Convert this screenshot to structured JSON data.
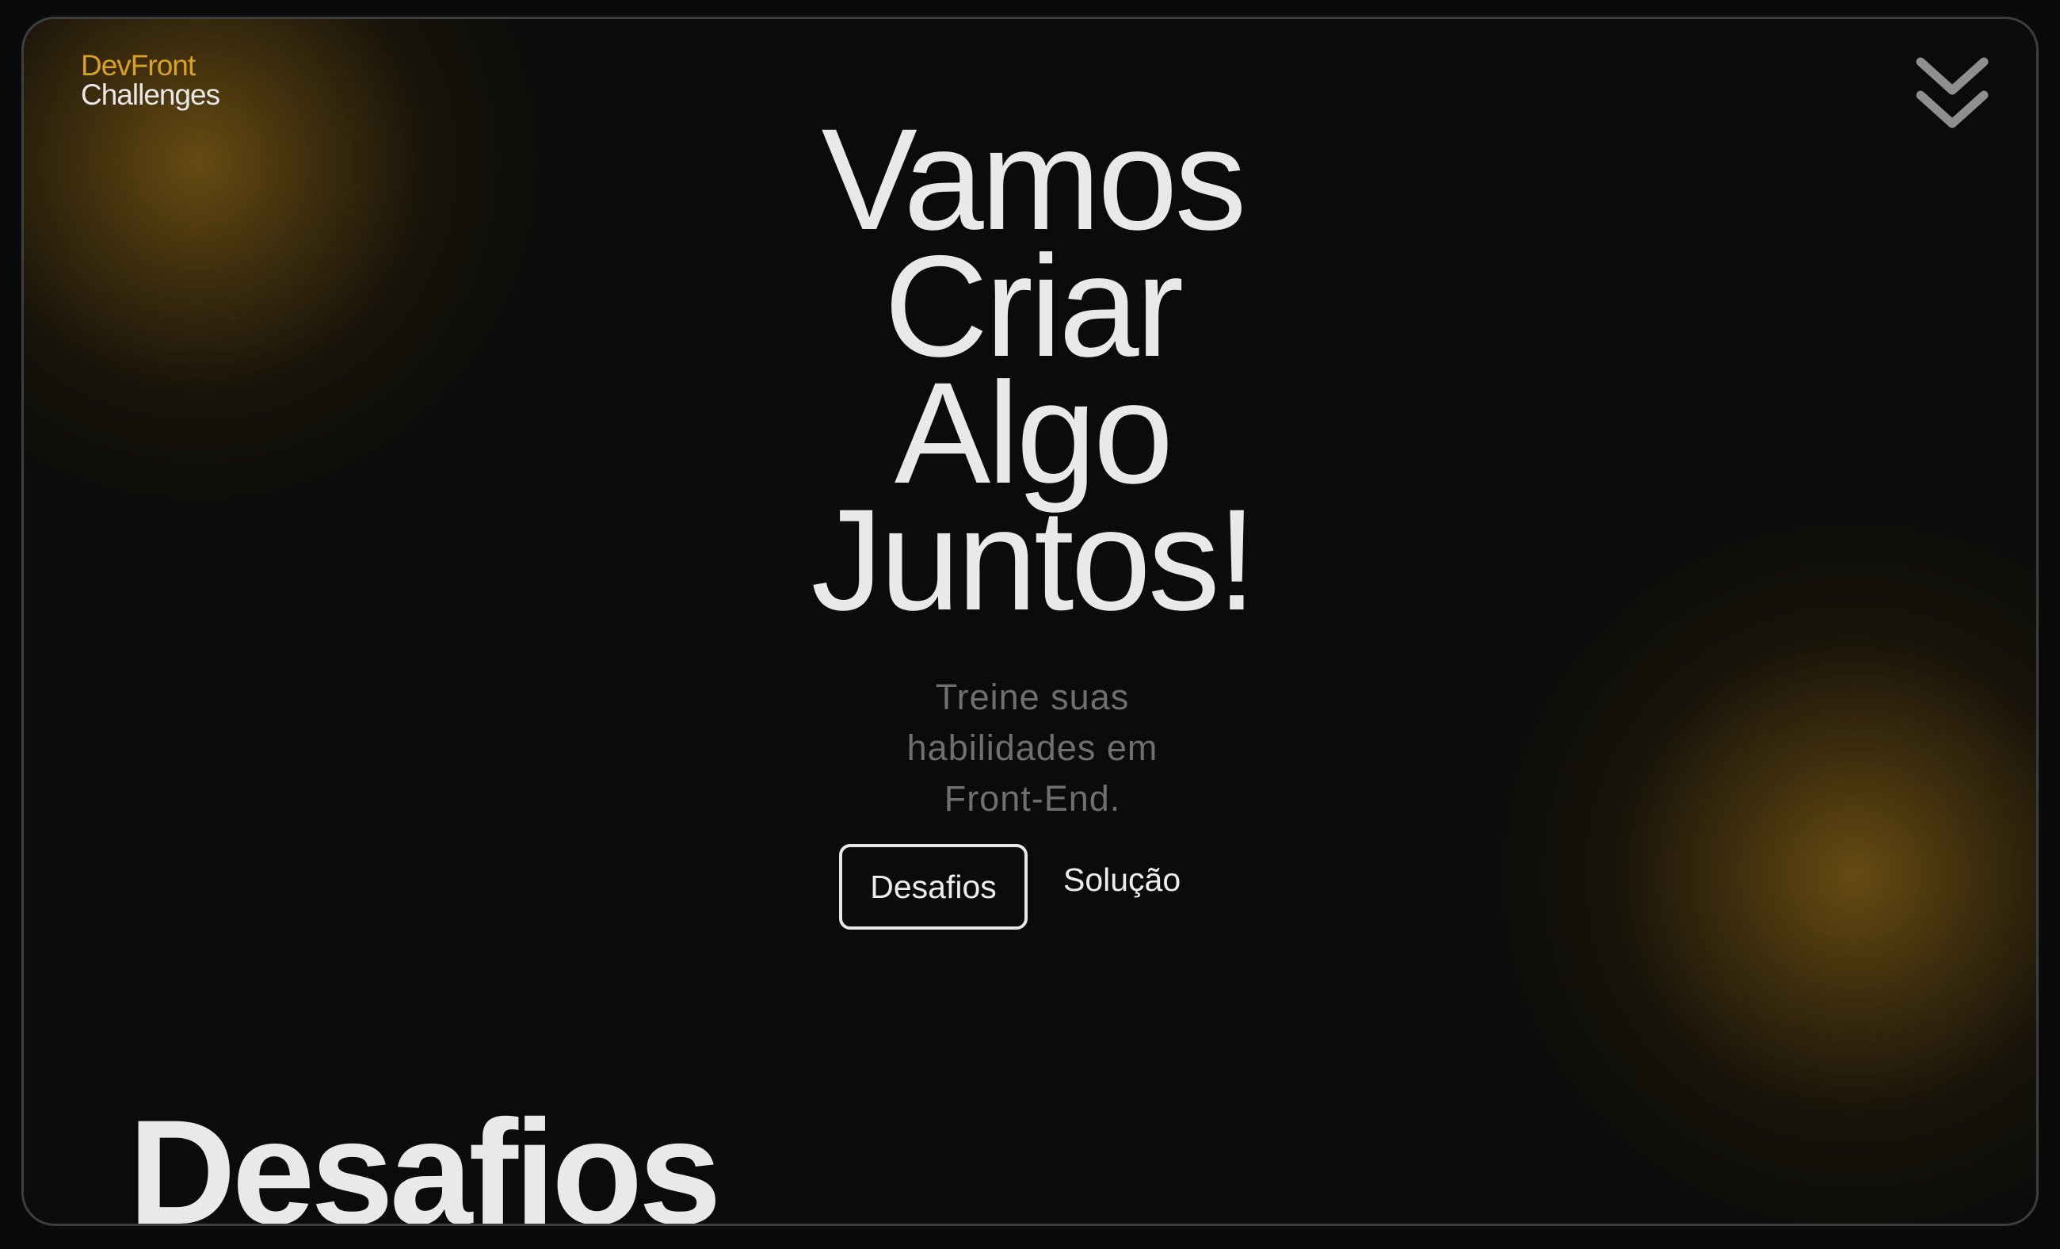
{
  "brand": {
    "line1": "DevFront",
    "line2": "Challenges",
    "accent_color": "#d9a21e"
  },
  "nav": {
    "scroll_icon": "double-chevron-down-icon"
  },
  "hero": {
    "headline": [
      "Vamos",
      "Criar",
      "Algo",
      "Juntos!"
    ],
    "subtitle": [
      "Treine suas",
      "habilidades em",
      "Front-End."
    ]
  },
  "actions": {
    "primary_label": "Desafios",
    "secondary_label": "Solução"
  },
  "section": {
    "title": "Desafios"
  }
}
